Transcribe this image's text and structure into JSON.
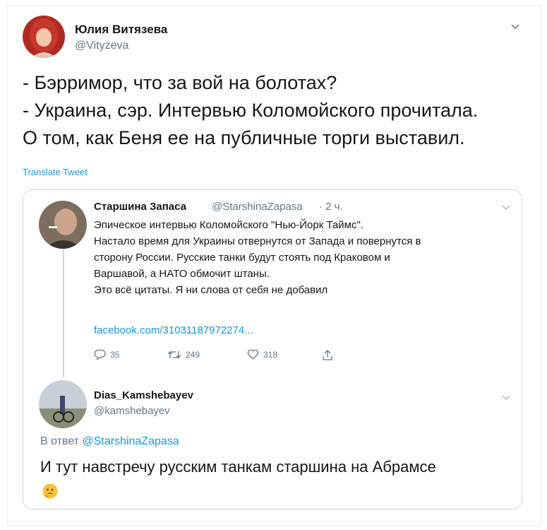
{
  "tweet": {
    "author_name": "Юлия Витязева",
    "author_handle": "@Vityzeva",
    "lines": [
      "- Бэрримор, что за вой на болотах?",
      "- Украина, сэр. Интервью Коломойского прочитала.",
      "О том, как Беня ее на публичные торги выставил."
    ],
    "translate_label": "Translate Tweet"
  },
  "quoted": {
    "author_name": "Старшина Запаса",
    "author_handle": "@StarshinaZapasa",
    "time": "· 2 ч.",
    "lines": [
      "Эпическое интервью Коломойского \"Нью-Йорк Таймс\".",
      "Настало время для Украины отвернутся от Запада и повернутся в",
      "сторону России. Русские танки будут стоять под Краковом и",
      "Варшавой, а НАТО обмочит штаны.",
      "Это всё цитаты. Я ни слова от себя не добавил"
    ],
    "link": "facebook.com/31031187972274...",
    "replies": "35",
    "retweets": "249",
    "likes": "318"
  },
  "reply": {
    "author_name": "Dias_Kamshebayev",
    "author_handle": "@kamshebayev",
    "reply_prefix": "В ответ",
    "reply_handle": "@StarshinaZapasa",
    "text": "И тут навстречу русским танкам старшина на Абрамсе",
    "emoji": "thinking-face"
  },
  "colors": {
    "accent": "#1b95e0",
    "secondary": "#657786",
    "border": "#ccd6dd"
  }
}
